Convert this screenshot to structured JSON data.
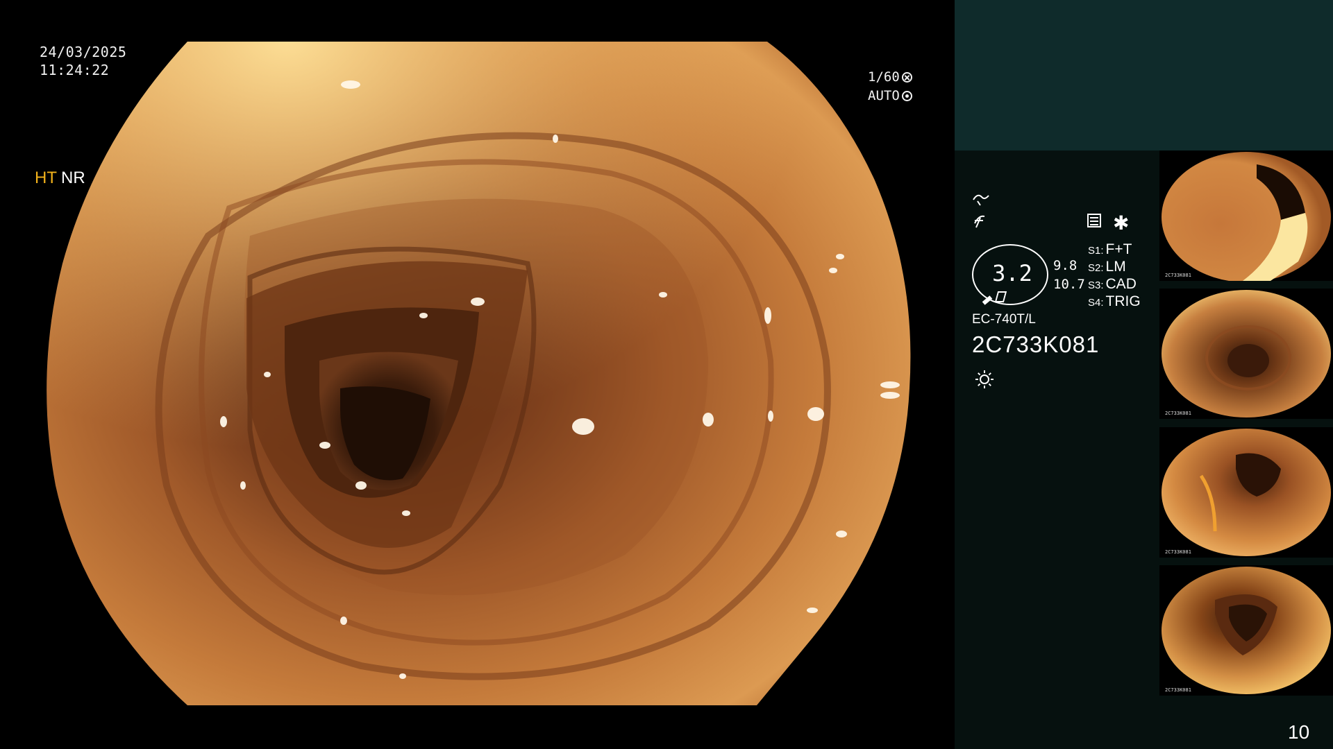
{
  "overlay": {
    "date": "24/03/2025",
    "time": "11:24:22",
    "shutter": "1/60",
    "exposure_mode": "AUTO"
  },
  "panel": {
    "modes": {
      "ht": "HT",
      "nr": "NR"
    },
    "gauge_value": "3.2",
    "side_values": [
      "9.8",
      "10.7"
    ],
    "scope_model": "EC-740T/L",
    "scope_serial": "2C733K081",
    "scene_settings": [
      {
        "key": "S1:",
        "value": "F+T"
      },
      {
        "key": "S2:",
        "value": "LM"
      },
      {
        "key": "S3:",
        "value": "CAD"
      },
      {
        "key": "S4:",
        "value": "TRIG"
      }
    ],
    "page_number": "10"
  },
  "thumbnails": [
    {
      "caption": "2C733K081"
    },
    {
      "caption": "2C733K081"
    },
    {
      "caption": "2C733K081"
    },
    {
      "caption": "2C733K081"
    }
  ],
  "colors": {
    "ht_accent": "#f2b21b",
    "panel_top_band": "#0f2b2b",
    "panel_background": "#06110f",
    "mucosa_dark": "#4a2210",
    "mucosa_mid": "#a8602c",
    "mucosa_light": "#e6a55a"
  },
  "icons": [
    "aperture-icon",
    "fan-icon",
    "curve-icon",
    "filter-icon",
    "settings-icon",
    "asterisk-icon",
    "light-icon"
  ]
}
